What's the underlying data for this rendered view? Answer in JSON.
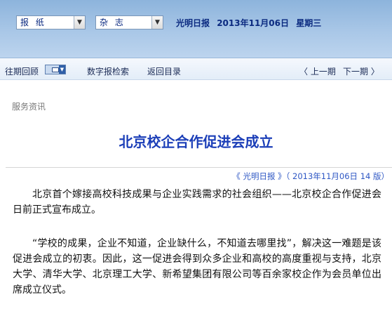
{
  "header": {
    "select_paper": "报 纸",
    "select_magazine": "杂 志",
    "paper_name": "光明日报",
    "date": "2013年11月06日",
    "weekday": "星期三"
  },
  "nav": {
    "back_issues": "往期回顾",
    "digital_search": "数字报检索",
    "back_to_toc": "返回目录",
    "prev": "〈 上一期",
    "next": "下一期 〉"
  },
  "article": {
    "category": "服务资讯",
    "title": "北京校企合作促进会成立",
    "source": "《 光明日报 》（ 2013年11月06日    14 版）",
    "paragraphs": [
      "北京首个嫁接高校科技成果与企业实践需求的社会组织——北京校企合作促进会日前正式宣布成立。",
      "“学校的成果，企业不知道，企业缺什么，不知道去哪里找”，解决这一难题是该促进会成立的初衷。因此，这一促进会得到众多企业和高校的高度重视与支持，北京大学、清华大学、北京理工大学、新希望集团有限公司等百余家校企作为会员单位出席成立仪式。"
    ]
  },
  "colors": {
    "header_blue": "#a9c7e7",
    "title_blue": "#1c3fb8",
    "source_blue": "#2e57c4"
  }
}
